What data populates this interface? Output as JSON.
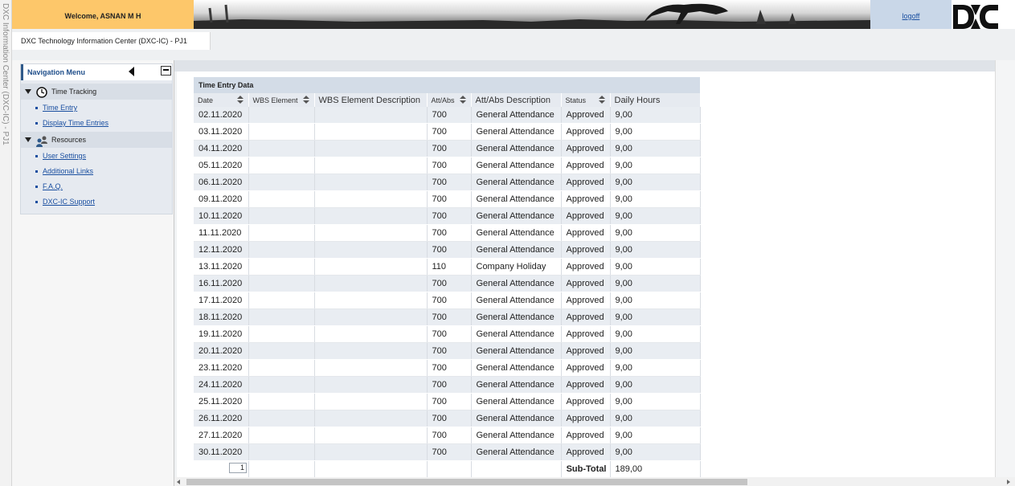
{
  "side_strip": {
    "text": "DXC Information Center (DXC-IC) - PJ1"
  },
  "header": {
    "welcome": "Welcome, ASNAN M H",
    "logoff": "logoff",
    "app_title": "DXC Technology Information Center (DXC-IC) - PJ1"
  },
  "nav": {
    "title": "Navigation Menu",
    "groups": [
      {
        "label": "Time Tracking",
        "icon": "clock-icon"
      },
      {
        "label": "Resources",
        "icon": "people-icon"
      }
    ],
    "links": [
      "Time Entry",
      "Display Time Entries",
      "User Settings",
      "Additional Links",
      "F.A.Q.",
      "DXC-IC Support"
    ]
  },
  "table": {
    "title": "Time Entry Data",
    "columns": [
      "Date",
      "WBS Element",
      "WBS Element Description",
      "Att/Abs",
      "Att/Abs Description",
      "Status",
      "Daily Hours"
    ],
    "rows": [
      [
        "02.11.2020",
        "",
        "",
        "700",
        "General Attendance",
        "Approved",
        "9,00"
      ],
      [
        "03.11.2020",
        "",
        "",
        "700",
        "General Attendance",
        "Approved",
        "9,00"
      ],
      [
        "04.11.2020",
        "",
        "",
        "700",
        "General Attendance",
        "Approved",
        "9,00"
      ],
      [
        "05.11.2020",
        "",
        "",
        "700",
        "General Attendance",
        "Approved",
        "9,00"
      ],
      [
        "06.11.2020",
        "",
        "",
        "700",
        "General Attendance",
        "Approved",
        "9,00"
      ],
      [
        "09.11.2020",
        "",
        "",
        "700",
        "General Attendance",
        "Approved",
        "9,00"
      ],
      [
        "10.11.2020",
        "",
        "",
        "700",
        "General Attendance",
        "Approved",
        "9,00"
      ],
      [
        "11.11.2020",
        "",
        "",
        "700",
        "General Attendance",
        "Approved",
        "9,00"
      ],
      [
        "12.11.2020",
        "",
        "",
        "700",
        "General Attendance",
        "Approved",
        "9,00"
      ],
      [
        "13.11.2020",
        "",
        "",
        "110",
        "Company Holiday",
        "Approved",
        "9,00"
      ],
      [
        "16.11.2020",
        "",
        "",
        "700",
        "General Attendance",
        "Approved",
        "9,00"
      ],
      [
        "17.11.2020",
        "",
        "",
        "700",
        "General Attendance",
        "Approved",
        "9,00"
      ],
      [
        "18.11.2020",
        "",
        "",
        "700",
        "General Attendance",
        "Approved",
        "9,00"
      ],
      [
        "19.11.2020",
        "",
        "",
        "700",
        "General Attendance",
        "Approved",
        "9,00"
      ],
      [
        "20.11.2020",
        "",
        "",
        "700",
        "General Attendance",
        "Approved",
        "9,00"
      ],
      [
        "23.11.2020",
        "",
        "",
        "700",
        "General Attendance",
        "Approved",
        "9,00"
      ],
      [
        "24.11.2020",
        "",
        "",
        "700",
        "General Attendance",
        "Approved",
        "9,00"
      ],
      [
        "25.11.2020",
        "",
        "",
        "700",
        "General Attendance",
        "Approved",
        "9,00"
      ],
      [
        "26.11.2020",
        "",
        "",
        "700",
        "General Attendance",
        "Approved",
        "9,00"
      ],
      [
        "27.11.2020",
        "",
        "",
        "700",
        "General Attendance",
        "Approved",
        "9,00"
      ],
      [
        "30.11.2020",
        "",
        "",
        "700",
        "General Attendance",
        "Approved",
        "9,00"
      ]
    ],
    "subtotal_label": "Sub-Total",
    "subtotal_value": "189,00",
    "page_number": "1"
  },
  "colors": {
    "welcome_bg": "#fdc76a",
    "logoff_bg": "#c9d7e8",
    "link": "#1a4fa0",
    "nav_accent": "#2f5a8a"
  }
}
